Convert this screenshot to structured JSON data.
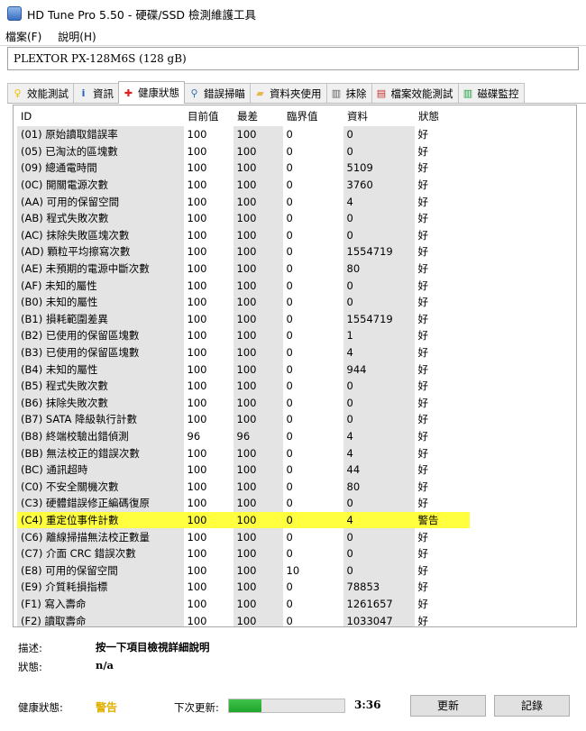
{
  "window": {
    "title": "HD Tune Pro 5.50 - 硬碟/SSD 檢測維護工具"
  },
  "menu": [
    {
      "label": "檔案(F)"
    },
    {
      "label": "說明(H)"
    }
  ],
  "drive": {
    "selected": "PLEXTOR PX-128M6S (128 gB)"
  },
  "tabs": [
    {
      "label": "效能測試",
      "icon": "lightbulb-icon",
      "color": "#f0c000"
    },
    {
      "label": "資訊",
      "icon": "info-icon",
      "color": "#2060c0"
    },
    {
      "label": "健康狀態",
      "icon": "red-cross-icon",
      "color": "#e02020",
      "active": true
    },
    {
      "label": "錯誤掃瞄",
      "icon": "magnifier-icon",
      "color": "#3070b0"
    },
    {
      "label": "資料夾使用",
      "icon": "folder-icon",
      "color": "#e8b84a"
    },
    {
      "label": "抹除",
      "icon": "trash-icon",
      "color": "#606060"
    },
    {
      "label": "檔案效能測試",
      "icon": "file-icon",
      "color": "#c03030"
    },
    {
      "label": "磁碟監控",
      "icon": "chart-icon",
      "color": "#20a040"
    }
  ],
  "table": {
    "headers": [
      "ID",
      "目前值",
      "最差",
      "臨界值",
      "資料",
      "狀態"
    ],
    "rows": [
      [
        "(01) 原始讀取錯誤率",
        "100",
        "100",
        "0",
        "0",
        "好"
      ],
      [
        "(05) 已淘汰的區塊數",
        "100",
        "100",
        "0",
        "0",
        "好"
      ],
      [
        "(09) 總通電時間",
        "100",
        "100",
        "0",
        "5109",
        "好"
      ],
      [
        "(0C) 開關電源次數",
        "100",
        "100",
        "0",
        "3760",
        "好"
      ],
      [
        "(AA) 可用的保留空間",
        "100",
        "100",
        "0",
        "4",
        "好"
      ],
      [
        "(AB) 程式失敗次數",
        "100",
        "100",
        "0",
        "0",
        "好"
      ],
      [
        "(AC) 抹除失敗區塊次數",
        "100",
        "100",
        "0",
        "0",
        "好"
      ],
      [
        "(AD) 顆粒平均擦寫次數",
        "100",
        "100",
        "0",
        "1554719",
        "好"
      ],
      [
        "(AE) 未預期的電源中斷次數",
        "100",
        "100",
        "0",
        "80",
        "好"
      ],
      [
        "(AF) 未知的屬性",
        "100",
        "100",
        "0",
        "0",
        "好"
      ],
      [
        "(B0) 未知的屬性",
        "100",
        "100",
        "0",
        "0",
        "好"
      ],
      [
        "(B1) 損耗範圍差異",
        "100",
        "100",
        "0",
        "1554719",
        "好"
      ],
      [
        "(B2) 已使用的保留區塊數",
        "100",
        "100",
        "0",
        "1",
        "好"
      ],
      [
        "(B3) 已使用的保留區塊數",
        "100",
        "100",
        "0",
        "4",
        "好"
      ],
      [
        "(B4) 未知的屬性",
        "100",
        "100",
        "0",
        "944",
        "好"
      ],
      [
        "(B5) 程式失敗次數",
        "100",
        "100",
        "0",
        "0",
        "好"
      ],
      [
        "(B6) 抹除失敗次數",
        "100",
        "100",
        "0",
        "0",
        "好"
      ],
      [
        "(B7) SATA 降級執行計數",
        "100",
        "100",
        "0",
        "0",
        "好"
      ],
      [
        "(B8) 終端校驗出錯偵測",
        "96",
        "96",
        "0",
        "4",
        "好"
      ],
      [
        "(BB) 無法校正的錯誤次數",
        "100",
        "100",
        "0",
        "4",
        "好"
      ],
      [
        "(BC) 通訊超時",
        "100",
        "100",
        "0",
        "44",
        "好"
      ],
      [
        "(C0) 不安全關機次數",
        "100",
        "100",
        "0",
        "80",
        "好"
      ],
      [
        "(C3) 硬體錯誤修正編碼復原",
        "100",
        "100",
        "0",
        "0",
        "好"
      ],
      [
        "(C4) 重定位事件計數",
        "100",
        "100",
        "0",
        "4",
        "警告"
      ],
      [
        "(C6) 離線掃描無法校正數量",
        "100",
        "100",
        "0",
        "0",
        "好"
      ],
      [
        "(C7) 介面 CRC 錯誤次數",
        "100",
        "100",
        "0",
        "0",
        "好"
      ],
      [
        "(E8) 可用的保留空間",
        "100",
        "100",
        "10",
        "0",
        "好"
      ],
      [
        "(E9) 介質耗損指標",
        "100",
        "100",
        "0",
        "78853",
        "好"
      ],
      [
        "(F1) 寫入壽命",
        "100",
        "100",
        "0",
        "1261657",
        "好"
      ],
      [
        "(F2) 讀取壽命",
        "100",
        "100",
        "0",
        "1033047",
        "好"
      ]
    ],
    "highlight_color": "#ffff40"
  },
  "details": {
    "description_label": "描述:",
    "description_value": "按一下項目檢視詳細說明",
    "status_label": "狀態:",
    "status_value": "n/a"
  },
  "status_bar": {
    "health_label": "健康狀態:",
    "health_value": "警告",
    "health_color": "#e0b000",
    "next_update_label": "下次更新:",
    "progress_fraction": 0.28,
    "timer": "3:36",
    "refresh_button": "更新",
    "log_button": "記錄"
  }
}
